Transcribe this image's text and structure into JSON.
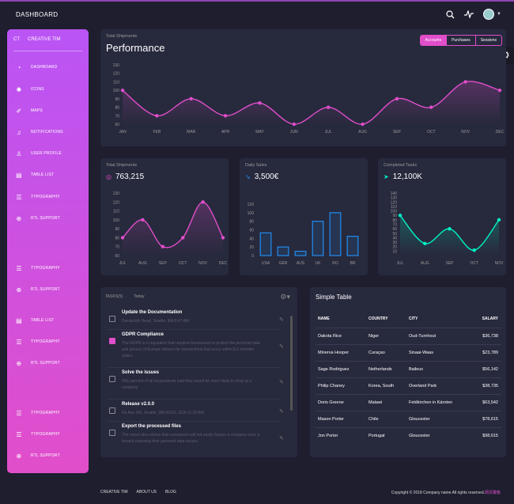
{
  "topbar": {
    "brand": "DASHBOARD"
  },
  "sidebar": {
    "logo_short": "CT",
    "logo_full": "CREATIVE TIM",
    "items": [
      {
        "label": "DASHBOARD",
        "icon": "dashboard-icon",
        "glyph": "◔"
      },
      {
        "label": "ICONS",
        "icon": "atom-icon",
        "glyph": "✺"
      },
      {
        "label": "MAPS",
        "icon": "pin-icon",
        "glyph": "✐"
      },
      {
        "label": "NOTIFICATIONS",
        "icon": "bell-icon",
        "glyph": "♫"
      },
      {
        "label": "USER PROFILE",
        "icon": "user-icon",
        "glyph": "♙"
      },
      {
        "label": "TABLE LIST",
        "icon": "puzzle-icon",
        "glyph": "▤"
      },
      {
        "label": "TYPOGRAPHY",
        "icon": "align-icon",
        "glyph": "☰"
      },
      {
        "label": "RTL SUPPORT",
        "icon": "world-icon",
        "glyph": "⊕"
      },
      {
        "label": "TYPOGRAPHY",
        "icon": "align-icon",
        "glyph": "☰"
      },
      {
        "label": "RTL SUPPORT",
        "icon": "world-icon",
        "glyph": "⊕"
      },
      {
        "label": "TABLE LIST",
        "icon": "puzzle-icon",
        "glyph": "▤"
      },
      {
        "label": "TYPOGRAPHY",
        "icon": "align-icon",
        "glyph": "☰"
      },
      {
        "label": "RTL SUPPORT",
        "icon": "world-icon",
        "glyph": "⊕"
      },
      {
        "label": "TYPOGRAPHY",
        "icon": "align-icon",
        "glyph": "☰"
      },
      {
        "label": "TYPOGRAPHY",
        "icon": "align-icon",
        "glyph": "☰"
      },
      {
        "label": "RTL SUPPORT",
        "icon": "world-icon",
        "glyph": "⊕"
      }
    ]
  },
  "performance": {
    "subtitle": "Total Shipments",
    "title": "Performance",
    "tabs": [
      "Accounts",
      "Purchases",
      "Sessions"
    ]
  },
  "shipments": {
    "subtitle": "Total Shipments",
    "value": "763,215"
  },
  "sales": {
    "subtitle": "Daily Sales",
    "value": "3,500€"
  },
  "tasks_done": {
    "subtitle": "Completed Tasks",
    "value": "12,100K"
  },
  "chart_data": [
    {
      "type": "line",
      "x": [
        "JAN",
        "FEB",
        "MAR",
        "APR",
        "MAY",
        "JUN",
        "JUL",
        "AUG",
        "SEP",
        "OCT",
        "NOV",
        "DEC"
      ],
      "series": [
        {
          "values": [
            100,
            70,
            90,
            70,
            85,
            60,
            80,
            60,
            90,
            80,
            110,
            100
          ]
        }
      ],
      "ylim": [
        60,
        130
      ],
      "yticks": [
        60,
        70,
        80,
        90,
        100,
        110,
        120,
        130
      ],
      "color": "#e14eca"
    },
    {
      "type": "line",
      "x": [
        "JUL",
        "AUG",
        "SEP",
        "OCT",
        "NOV",
        "DEC"
      ],
      "series": [
        {
          "values": [
            80,
            100,
            70,
            80,
            120,
            80
          ]
        }
      ],
      "ylim": [
        60,
        130
      ],
      "yticks": [
        60,
        70,
        80,
        90,
        100,
        110,
        120,
        130
      ],
      "color": "#e14eca"
    },
    {
      "type": "bar",
      "categories": [
        "USA",
        "GER",
        "AUS",
        "UK",
        "RO",
        "BR"
      ],
      "values": [
        53,
        20,
        10,
        80,
        100,
        45
      ],
      "ylim": [
        0,
        120
      ],
      "yticks": [
        0,
        20,
        40,
        60,
        80,
        100,
        120
      ],
      "color": "#1f8ef1"
    },
    {
      "type": "line",
      "x": [
        "JUL",
        "AUG",
        "SEP",
        "OCT",
        "NOV"
      ],
      "series": [
        {
          "values": [
            90,
            27,
            60,
            12,
            80
          ]
        }
      ],
      "ylim": [
        0,
        140
      ],
      "yticks": [
        10,
        20,
        30,
        40,
        50,
        60,
        70,
        80,
        90,
        100,
        110,
        120,
        130,
        140
      ],
      "color": "#00f2c3"
    }
  ],
  "tasks": {
    "header_tab": "TASKS(5)",
    "header_sub": "Today",
    "items": [
      {
        "title": "Update the Documentation",
        "desc": "Dwuamish Head, Seattle, WA 8:47 AM",
        "checked": false
      },
      {
        "title": "GDPR Compliance",
        "desc": "The GDPR is a regulation that requires businesses to protect the personal data and privacy of Europe citizens for transactions that occur within EU member states.",
        "checked": true
      },
      {
        "title": "Solve the issues",
        "desc": "Fifty percent of all respondents said they would be more likely to shop at a company",
        "checked": false
      },
      {
        "title": "Release v2.0.0",
        "desc": "Ra Ave SW, Seattle, WA 98116, SUA 11:19 AM",
        "checked": false
      },
      {
        "title": "Export the processed files",
        "desc": "The report also shows that consumers will not easily forgive a company once a breach exposing their personal data occurs.",
        "checked": false
      }
    ]
  },
  "table": {
    "title": "Simple Table",
    "headers": [
      "NAME",
      "COUNTRY",
      "CITY",
      "SALARY"
    ],
    "rows": [
      [
        "Dakota Rice",
        "Niger",
        "Oud-Turnhout",
        "$36,738"
      ],
      [
        "Minerva Hooper",
        "Curaçao",
        "Sinaai-Waas",
        "$23,789"
      ],
      [
        "Sage Rodriguez",
        "Netherlands",
        "Baileux",
        "$56,142"
      ],
      [
        "Philip Chaney",
        "Korea, South",
        "Overland Park",
        "$38,735"
      ],
      [
        "Doris Greene",
        "Malawi",
        "Feldkirchen in Kärnten",
        "$63,542"
      ],
      [
        "Mason Porter",
        "Chile",
        "Gloucester",
        "$78,615"
      ],
      [
        "Jon Porter",
        "Portugal",
        "Gloucester",
        "$98,615"
      ]
    ]
  },
  "footer": {
    "links": [
      "CREATIVE TIM",
      "ABOUT US",
      "BLOG"
    ],
    "copyright": "Copyright © 2018 Company name All rights reserved.",
    "accent": "网页模板"
  },
  "colors": {
    "accent": "#e14eca",
    "blue": "#1f8ef1",
    "teal": "#00f2c3",
    "bg": "#1e1e2f",
    "card": "#27293d"
  }
}
